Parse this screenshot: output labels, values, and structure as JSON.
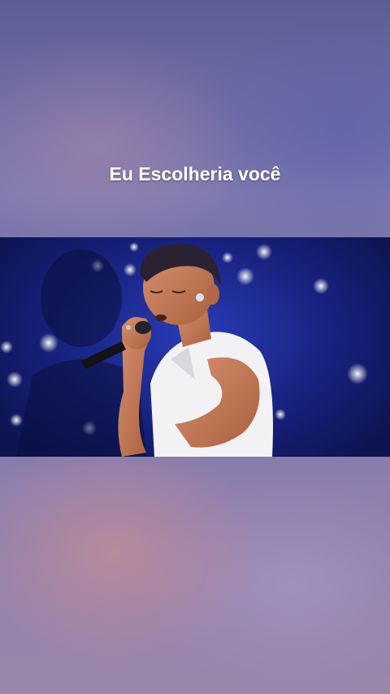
{
  "caption": {
    "text": "Eu Escolheria você"
  },
  "video": {
    "description_icon": "video-frame"
  },
  "colors": {
    "stage_blue": "#1e2c9a",
    "shirt": "#f2f2f4",
    "skin": "#c27a5a"
  }
}
